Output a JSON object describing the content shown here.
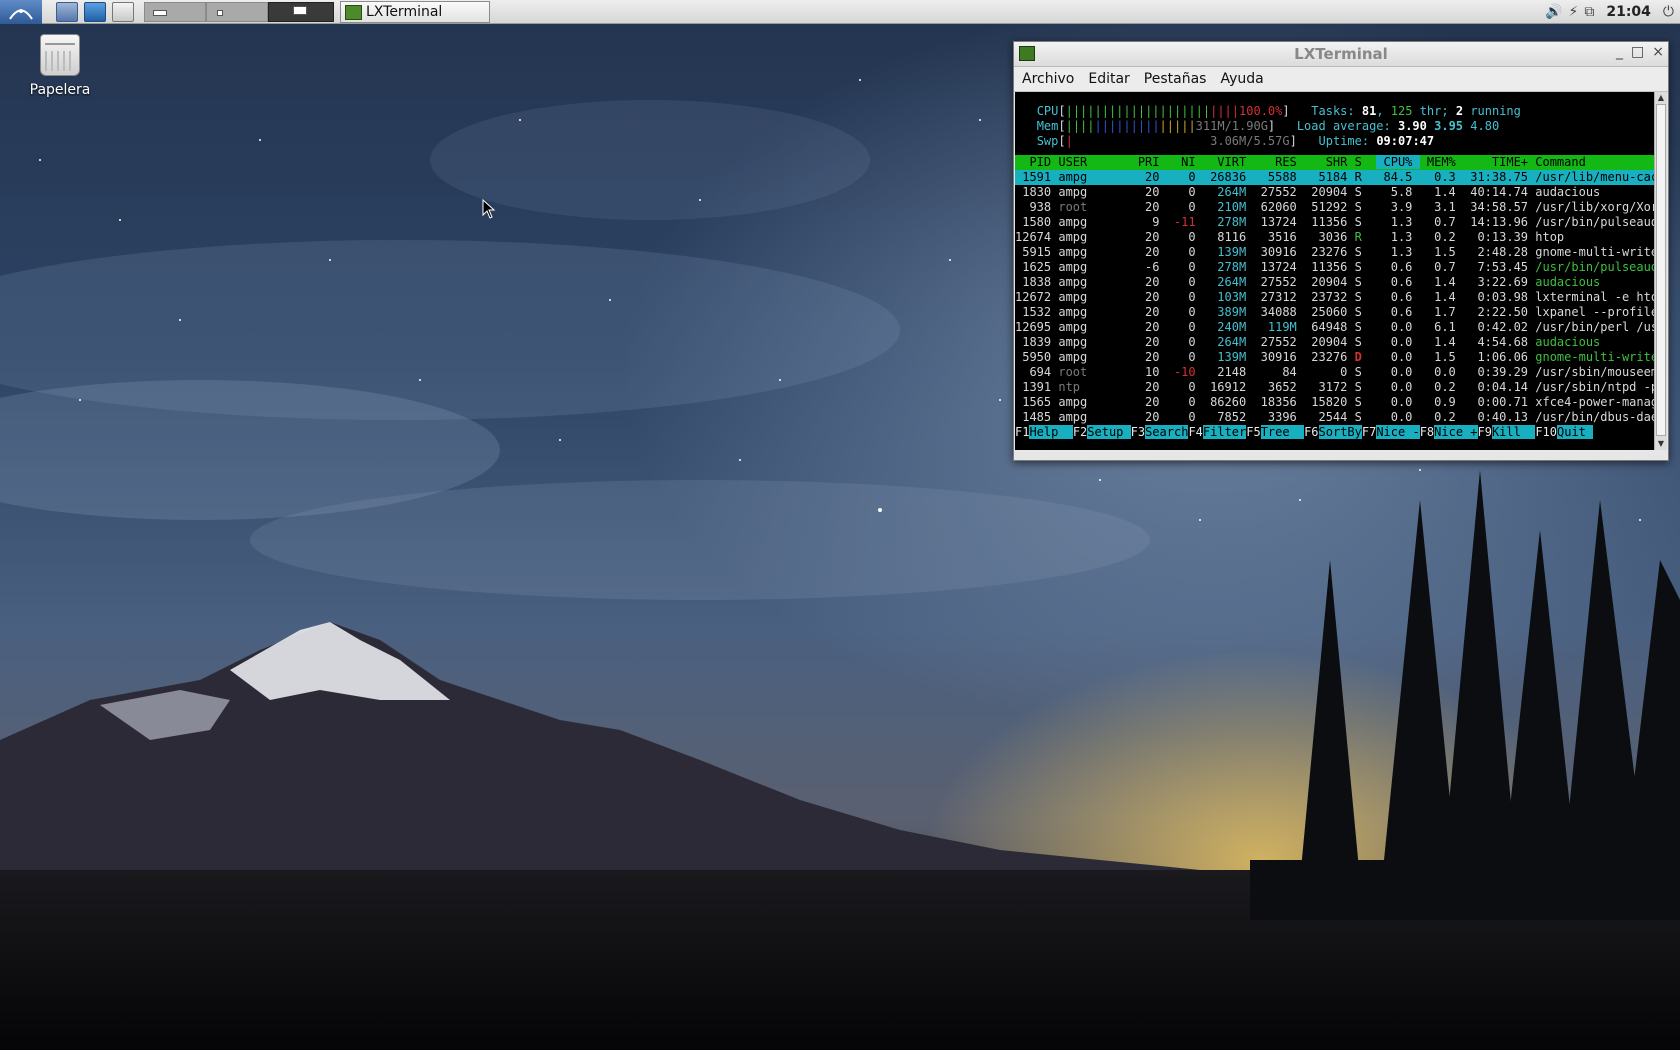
{
  "desktop": {
    "trash_label": "Papelera"
  },
  "panel": {
    "task_title": "LXTerminal",
    "clock": "21:04",
    "icons": [
      "menu-icon",
      "file-manager-icon",
      "browser-icon",
      "terminal-icon",
      "volume-icon",
      "battery-icon",
      "network-icon",
      "power-icon"
    ]
  },
  "terminal": {
    "title": "LXTerminal",
    "menu": [
      "Archivo",
      "Editar",
      "Pestañas",
      "Ayuda"
    ],
    "window_controls": [
      "_",
      "□",
      "×"
    ]
  },
  "htop": {
    "cpu": {
      "label": "CPU",
      "bars_green": "||||||||||||||||||||",
      "bars_red": "||||",
      "value": "100.0%"
    },
    "mem": {
      "label": "Mem",
      "bars_green": "||||",
      "bars_blue": "|||||||||",
      "bars_yellow": "|||||",
      "value": "311M/1.90G"
    },
    "swp": {
      "label": "Swp",
      "bars_red": "|",
      "value": "3.06M/5.57G"
    },
    "tasks": {
      "label": "Tasks:",
      "count": "81",
      "thr": "125",
      "thr_label": "thr;",
      "running": "2",
      "running_label": "running"
    },
    "load": {
      "label": "Load average:",
      "l1": "3.90",
      "l5": "3.95",
      "l15": "4.80"
    },
    "uptime": {
      "label": "Uptime:",
      "value": "09:07:47"
    },
    "columns": [
      "PID",
      "USER",
      "PRI",
      "NI",
      "VIRT",
      "RES",
      "SHR",
      "S",
      "CPU%",
      "MEM%",
      "TIME+",
      "Command"
    ],
    "processes": [
      {
        "pid": "1591",
        "user": "ampg",
        "pri": "20",
        "ni": "0",
        "virt": "26836",
        "res": "5588",
        "shr": "5184",
        "s": "R",
        "cpu": "84.5",
        "mem": "0.3",
        "time": "31:38.75",
        "cmd": "/usr/lib/menu-cac"
      },
      {
        "pid": "1830",
        "user": "ampg",
        "pri": "20",
        "ni": "0",
        "virt": "264M",
        "res": "27552",
        "shr": "20904",
        "s": "S",
        "cpu": "5.8",
        "mem": "1.4",
        "time": "40:14.74",
        "cmd": "audacious"
      },
      {
        "pid": "938",
        "user": "root",
        "pri": "20",
        "ni": "0",
        "virt": "210M",
        "res": "62060",
        "shr": "51292",
        "s": "S",
        "cpu": "3.9",
        "mem": "3.1",
        "time": "34:58.57",
        "cmd": "/usr/lib/xorg/Xor"
      },
      {
        "pid": "1580",
        "user": "ampg",
        "pri": "9",
        "ni": "-11",
        "virt": "278M",
        "res": "13724",
        "shr": "11356",
        "s": "S",
        "cpu": "1.3",
        "mem": "0.7",
        "time": "14:13.96",
        "cmd": "/usr/bin/pulseaud"
      },
      {
        "pid": "12674",
        "user": "ampg",
        "pri": "20",
        "ni": "0",
        "virt": "8116",
        "res": "3516",
        "shr": "3036",
        "s": "R",
        "cpu": "1.3",
        "mem": "0.2",
        "time": "0:13.39",
        "cmd": "htop"
      },
      {
        "pid": "5915",
        "user": "ampg",
        "pri": "20",
        "ni": "0",
        "virt": "139M",
        "res": "30916",
        "shr": "23276",
        "s": "S",
        "cpu": "1.3",
        "mem": "1.5",
        "time": "2:48.28",
        "cmd": "gnome-multi-write"
      },
      {
        "pid": "1625",
        "user": "ampg",
        "pri": "-6",
        "ni": "0",
        "virt": "278M",
        "res": "13724",
        "shr": "11356",
        "s": "S",
        "cpu": "0.6",
        "mem": "0.7",
        "time": "7:53.45",
        "cmd": "/usr/bin/pulseaud"
      },
      {
        "pid": "1838",
        "user": "ampg",
        "pri": "20",
        "ni": "0",
        "virt": "264M",
        "res": "27552",
        "shr": "20904",
        "s": "S",
        "cpu": "0.6",
        "mem": "1.4",
        "time": "3:22.69",
        "cmd": "audacious"
      },
      {
        "pid": "12672",
        "user": "ampg",
        "pri": "20",
        "ni": "0",
        "virt": "103M",
        "res": "27312",
        "shr": "23732",
        "s": "S",
        "cpu": "0.6",
        "mem": "1.4",
        "time": "0:03.98",
        "cmd": "lxterminal -e hto"
      },
      {
        "pid": "1532",
        "user": "ampg",
        "pri": "20",
        "ni": "0",
        "virt": "389M",
        "res": "34088",
        "shr": "25060",
        "s": "S",
        "cpu": "0.6",
        "mem": "1.7",
        "time": "2:22.50",
        "cmd": "lxpanel --profile"
      },
      {
        "pid": "12695",
        "user": "ampg",
        "pri": "20",
        "ni": "0",
        "virt": "240M",
        "res": "119M",
        "shr": "64948",
        "s": "S",
        "cpu": "0.0",
        "mem": "6.1",
        "time": "0:42.02",
        "cmd": "/usr/bin/perl /us"
      },
      {
        "pid": "1839",
        "user": "ampg",
        "pri": "20",
        "ni": "0",
        "virt": "264M",
        "res": "27552",
        "shr": "20904",
        "s": "S",
        "cpu": "0.0",
        "mem": "1.4",
        "time": "4:54.68",
        "cmd": "audacious"
      },
      {
        "pid": "5950",
        "user": "ampg",
        "pri": "20",
        "ni": "0",
        "virt": "139M",
        "res": "30916",
        "shr": "23276",
        "s": "D",
        "cpu": "0.0",
        "mem": "1.5",
        "time": "1:06.06",
        "cmd": "gnome-multi-write"
      },
      {
        "pid": "694",
        "user": "root",
        "pri": "10",
        "ni": "-10",
        "virt": "2148",
        "res": "84",
        "shr": "0",
        "s": "S",
        "cpu": "0.0",
        "mem": "0.0",
        "time": "0:39.29",
        "cmd": "/usr/sbin/mouseem"
      },
      {
        "pid": "1391",
        "user": "ntp",
        "pri": "20",
        "ni": "0",
        "virt": "16912",
        "res": "3652",
        "shr": "3172",
        "s": "S",
        "cpu": "0.0",
        "mem": "0.2",
        "time": "0:04.14",
        "cmd": "/usr/sbin/ntpd -p"
      },
      {
        "pid": "1565",
        "user": "ampg",
        "pri": "20",
        "ni": "0",
        "virt": "86260",
        "res": "18356",
        "shr": "15820",
        "s": "S",
        "cpu": "0.0",
        "mem": "0.9",
        "time": "0:00.71",
        "cmd": "xfce4-power-manag"
      },
      {
        "pid": "1485",
        "user": "ampg",
        "pri": "20",
        "ni": "0",
        "virt": "7852",
        "res": "3396",
        "shr": "2544",
        "s": "S",
        "cpu": "0.0",
        "mem": "0.2",
        "time": "0:40.13",
        "cmd": "/usr/bin/dbus-dae"
      }
    ],
    "fkeys": [
      {
        "key": "F1",
        "label": "Help  "
      },
      {
        "key": "F2",
        "label": "Setup "
      },
      {
        "key": "F3",
        "label": "Search"
      },
      {
        "key": "F4",
        "label": "Filter"
      },
      {
        "key": "F5",
        "label": "Tree  "
      },
      {
        "key": "F6",
        "label": "SortBy"
      },
      {
        "key": "F7",
        "label": "Nice -"
      },
      {
        "key": "F8",
        "label": "Nice +"
      },
      {
        "key": "F9",
        "label": "Kill  "
      },
      {
        "key": "F10",
        "label": "Quit "
      }
    ]
  }
}
